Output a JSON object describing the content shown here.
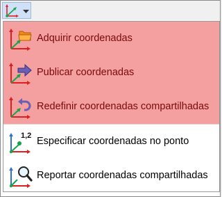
{
  "toolbar": {
    "button_icon": "coordinate-system-icon",
    "dropdown_icon": "chevron-down-icon"
  },
  "menu": {
    "items": [
      {
        "label": "Adquirir coordenadas",
        "icon": "acquire-coordinates-icon",
        "highlighted": true
      },
      {
        "label": "Publicar coordenadas",
        "icon": "publish-coordinates-icon",
        "highlighted": true
      },
      {
        "label": "Redefinir coordenadas compartilhadas",
        "icon": "reset-shared-coordinates-icon",
        "highlighted": true
      },
      {
        "label": "Especificar coordenadas no ponto",
        "icon": "specify-coordinates-at-point-icon",
        "highlighted": false,
        "icon_text": "1,2"
      },
      {
        "label": "Reportar coordenadas compartilhadas",
        "icon": "report-shared-coordinates-icon",
        "highlighted": false
      }
    ]
  },
  "colors": {
    "highlight": "#f4a0a0",
    "axis_red": "#e02020",
    "axis_green": "#16a34a",
    "axis_blue": "#2f6fd6",
    "highlight_text": "#7a0a0a"
  }
}
